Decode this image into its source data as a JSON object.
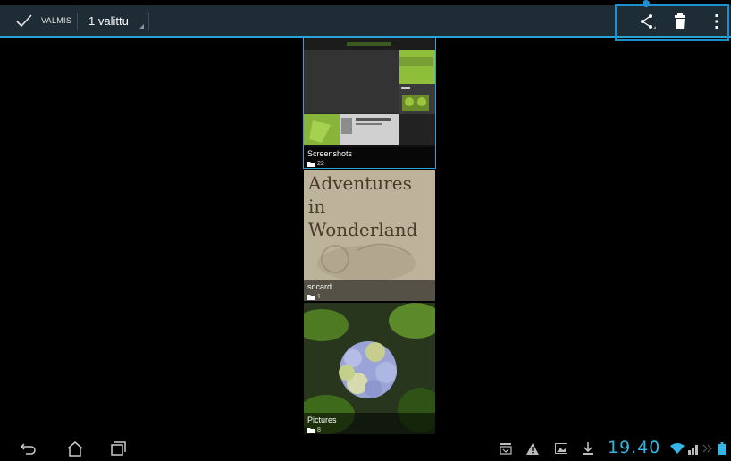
{
  "action_bar": {
    "done_label": "VALMIS",
    "selection_label": "1 valittu",
    "actions": [
      {
        "name": "share",
        "icon": "share-icon"
      },
      {
        "name": "delete",
        "icon": "trash-icon"
      },
      {
        "name": "overflow",
        "icon": "more-vert-icon"
      }
    ]
  },
  "albums": [
    {
      "name": "Screenshots",
      "count": "22",
      "selected": true
    },
    {
      "name": "sdcard",
      "count": "1",
      "cover_text": [
        "Adventures",
        "in Wonderland"
      ]
    },
    {
      "name": "Pictures",
      "count": "8"
    }
  ],
  "system_bar": {
    "time": "19.40",
    "nav_buttons": [
      "back-icon",
      "home-icon",
      "recent-apps-icon"
    ],
    "status_icons": [
      "tray-icon",
      "warning-icon",
      "gallery-icon",
      "download-icon",
      "wifi-icon",
      "signal-icon",
      "battery-icon"
    ]
  },
  "colors": {
    "accent": "#33b5e5",
    "action_bar": "#1e2c35",
    "highlight": "#1e8fd0"
  }
}
